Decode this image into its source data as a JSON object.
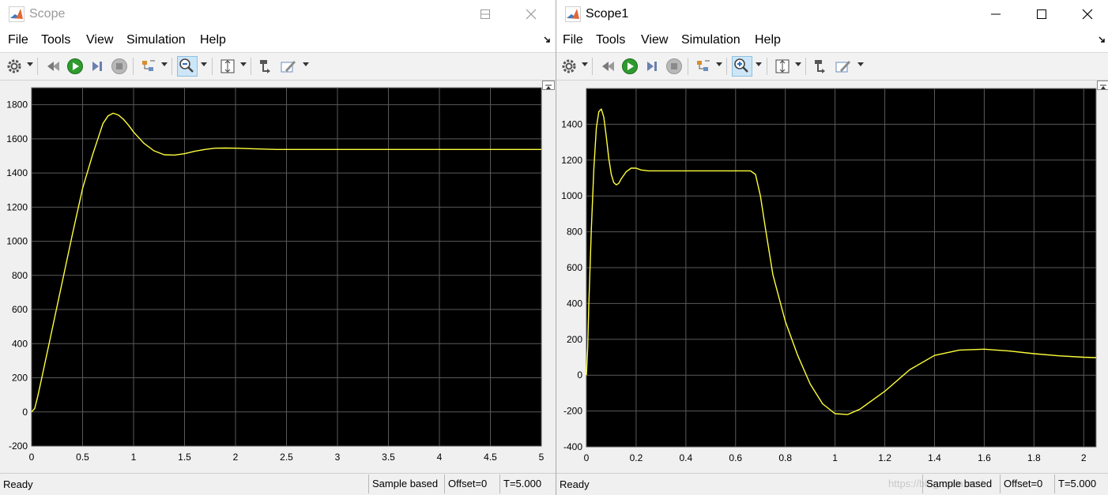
{
  "windows": [
    {
      "title": "Scope",
      "menus": [
        "File",
        "Tools",
        "View",
        "Simulation",
        "Help"
      ],
      "status": {
        "ready": "Ready",
        "mode": "Sample based",
        "offset": "Offset=0",
        "time": "T=5.000"
      }
    },
    {
      "title": "Scope1",
      "menus": [
        "File",
        "Tools",
        "View",
        "Simulation",
        "Help"
      ],
      "status": {
        "ready": "Ready",
        "mode": "Sample based",
        "offset": "Offset=0",
        "time": "T=5.000"
      }
    }
  ],
  "watermark": "https://blog.csdn.net/...",
  "toolbar_icons": [
    "settings-icon",
    "step-back-icon",
    "run-icon",
    "step-forward-icon",
    "stop-icon",
    "signal-select-icon",
    "zoom-icon",
    "autoscale-icon",
    "highlight-block-icon",
    "edit-icon"
  ],
  "colors": {
    "plot_bg": "#000000",
    "grid": "#5a5a5a",
    "trace": "#ffff3c",
    "tick_text": "#000000"
  },
  "chart_data": [
    {
      "type": "line",
      "title": "",
      "xlabel": "",
      "ylabel": "",
      "xlim": [
        0,
        5
      ],
      "ylim": [
        -200,
        1900
      ],
      "grid": true,
      "xticks": [
        0,
        0.5,
        1,
        1.5,
        2,
        2.5,
        3,
        3.5,
        4,
        4.5,
        5
      ],
      "xtick_labels": [
        "0",
        "0.5",
        "1",
        "1.5",
        "2",
        "2.5",
        "3",
        "3.5",
        "4",
        "4.5",
        "5"
      ],
      "yticks": [
        -200,
        0,
        200,
        400,
        600,
        800,
        1000,
        1200,
        1400,
        1600,
        1800
      ],
      "ytick_labels": [
        "-200",
        "0",
        "200",
        "400",
        "600",
        "800",
        "1000",
        "1200",
        "1400",
        "1600",
        "1800"
      ],
      "series": [
        {
          "x": [
            0,
            0.03,
            0.06,
            0.1,
            0.2,
            0.3,
            0.4,
            0.5,
            0.6,
            0.7,
            0.75,
            0.8,
            0.85,
            0.9,
            0.95,
            1.0,
            1.1,
            1.2,
            1.3,
            1.4,
            1.5,
            1.6,
            1.7,
            1.8,
            1.9,
            2.0,
            2.2,
            2.4,
            2.6,
            3.0,
            3.5,
            4.0,
            4.5,
            5.0
          ],
          "y": [
            0,
            20,
            90,
            200,
            480,
            760,
            1040,
            1310,
            1510,
            1690,
            1735,
            1750,
            1740,
            1715,
            1680,
            1640,
            1575,
            1530,
            1507,
            1505,
            1513,
            1527,
            1538,
            1545,
            1546,
            1545,
            1541,
            1538,
            1538,
            1538,
            1538,
            1538,
            1538,
            1538
          ]
        }
      ]
    },
    {
      "type": "line",
      "title": "",
      "xlabel": "",
      "ylabel": "",
      "xlim": [
        0,
        2.05
      ],
      "ylim": [
        -400,
        1600
      ],
      "grid": true,
      "xticks": [
        0,
        0.2,
        0.4,
        0.6,
        0.8,
        1,
        1.2,
        1.4,
        1.6,
        1.8,
        2
      ],
      "xtick_labels": [
        "0",
        "0.2",
        "0.4",
        "0.6",
        "0.8",
        "1",
        "1.2",
        "1.4",
        "1.6",
        "1.8",
        "2"
      ],
      "yticks": [
        -400,
        -200,
        0,
        200,
        400,
        600,
        800,
        1000,
        1200,
        1400
      ],
      "ytick_labels": [
        "-400",
        "-200",
        "0",
        "200",
        "400",
        "600",
        "800",
        "1000",
        "1200",
        "1400"
      ],
      "series": [
        {
          "x": [
            0,
            0.005,
            0.01,
            0.02,
            0.03,
            0.04,
            0.05,
            0.06,
            0.07,
            0.08,
            0.09,
            0.1,
            0.11,
            0.12,
            0.13,
            0.14,
            0.16,
            0.18,
            0.2,
            0.22,
            0.25,
            0.3,
            0.4,
            0.5,
            0.6,
            0.66,
            0.68,
            0.7,
            0.72,
            0.75,
            0.8,
            0.85,
            0.9,
            0.95,
            1.0,
            1.05,
            1.1,
            1.2,
            1.3,
            1.4,
            1.5,
            1.6,
            1.7,
            1.8,
            1.9,
            2.0,
            2.05
          ],
          "y": [
            0,
            150,
            400,
            820,
            1150,
            1380,
            1470,
            1485,
            1440,
            1330,
            1210,
            1120,
            1075,
            1062,
            1070,
            1095,
            1135,
            1155,
            1155,
            1145,
            1140,
            1140,
            1140,
            1140,
            1140,
            1140,
            1120,
            1000,
            820,
            560,
            300,
            110,
            -50,
            -160,
            -215,
            -220,
            -190,
            -90,
            30,
            110,
            140,
            145,
            135,
            120,
            108,
            100,
            98
          ]
        }
      ]
    }
  ]
}
